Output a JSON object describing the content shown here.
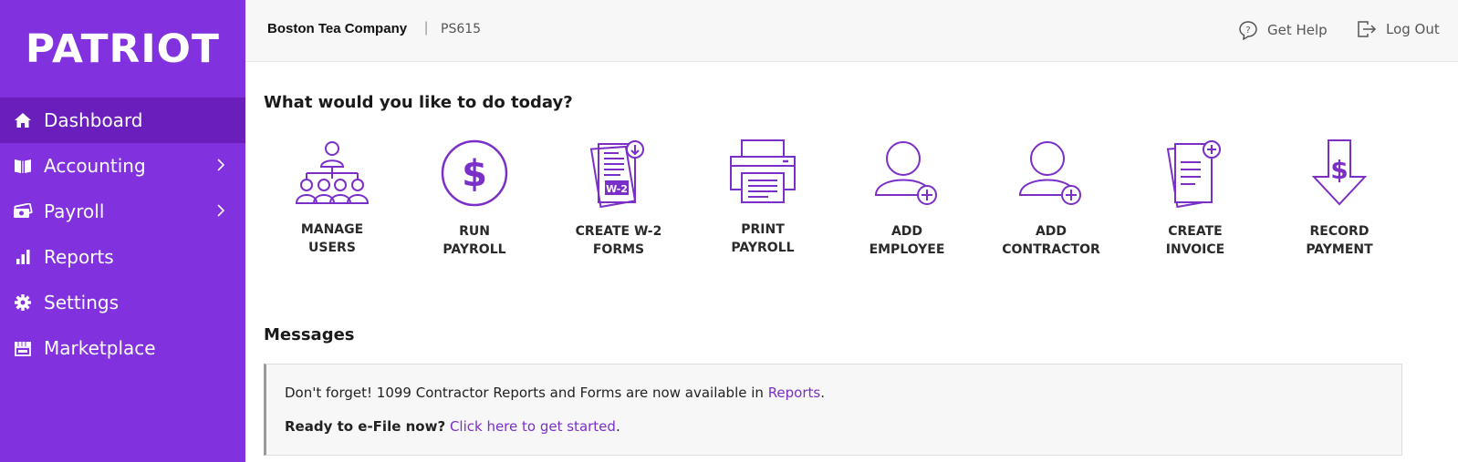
{
  "brand": {
    "name": "PATRIOT",
    "accent": "#8131dd",
    "active": "#6a1fbd",
    "icon_color": "#7b2fc9"
  },
  "header": {
    "company": "Boston Tea Company",
    "separator": "|",
    "account_id": "PS615",
    "help_label": "Get Help",
    "logout_label": "Log Out"
  },
  "sidebar": {
    "items": [
      {
        "label": "Dashboard",
        "icon": "home-icon",
        "active": true,
        "has_submenu": false
      },
      {
        "label": "Accounting",
        "icon": "book-icon",
        "active": false,
        "has_submenu": true
      },
      {
        "label": "Payroll",
        "icon": "money-icon",
        "active": false,
        "has_submenu": true
      },
      {
        "label": "Reports",
        "icon": "bar-chart-icon",
        "active": false,
        "has_submenu": false
      },
      {
        "label": "Settings",
        "icon": "gear-icon",
        "active": false,
        "has_submenu": false
      },
      {
        "label": "Marketplace",
        "icon": "storefront-icon",
        "active": false,
        "has_submenu": false
      }
    ]
  },
  "main": {
    "today_title": "What would you like to do today?",
    "actions": [
      {
        "line1": "MANAGE",
        "line2": "USERS",
        "icon": "org-chart-icon"
      },
      {
        "line1": "RUN",
        "line2": "PAYROLL",
        "icon": "dollar-circle-icon"
      },
      {
        "line1": "CREATE W-2",
        "line2": "FORMS",
        "icon": "w2-form-icon"
      },
      {
        "line1": "PRINT",
        "line2": "PAYROLL",
        "icon": "printer-icon"
      },
      {
        "line1": "ADD",
        "line2": "EMPLOYEE",
        "icon": "add-person-icon"
      },
      {
        "line1": "ADD",
        "line2": "CONTRACTOR",
        "icon": "add-person-icon"
      },
      {
        "line1": "CREATE",
        "line2": "INVOICE",
        "icon": "invoice-add-icon"
      },
      {
        "line1": "RECORD",
        "line2": "PAYMENT",
        "icon": "dollar-arrow-down-icon"
      }
    ],
    "w2_badge": "W-2",
    "messages_title": "Messages",
    "message1_text": "Don't forget! 1099 Contractor Reports and Forms are now available in ",
    "message1_link": "Reports",
    "message1_end": ".",
    "message2_bold": "Ready to e-File now?",
    "message2_link": "Click here to get started",
    "message2_end": "."
  }
}
